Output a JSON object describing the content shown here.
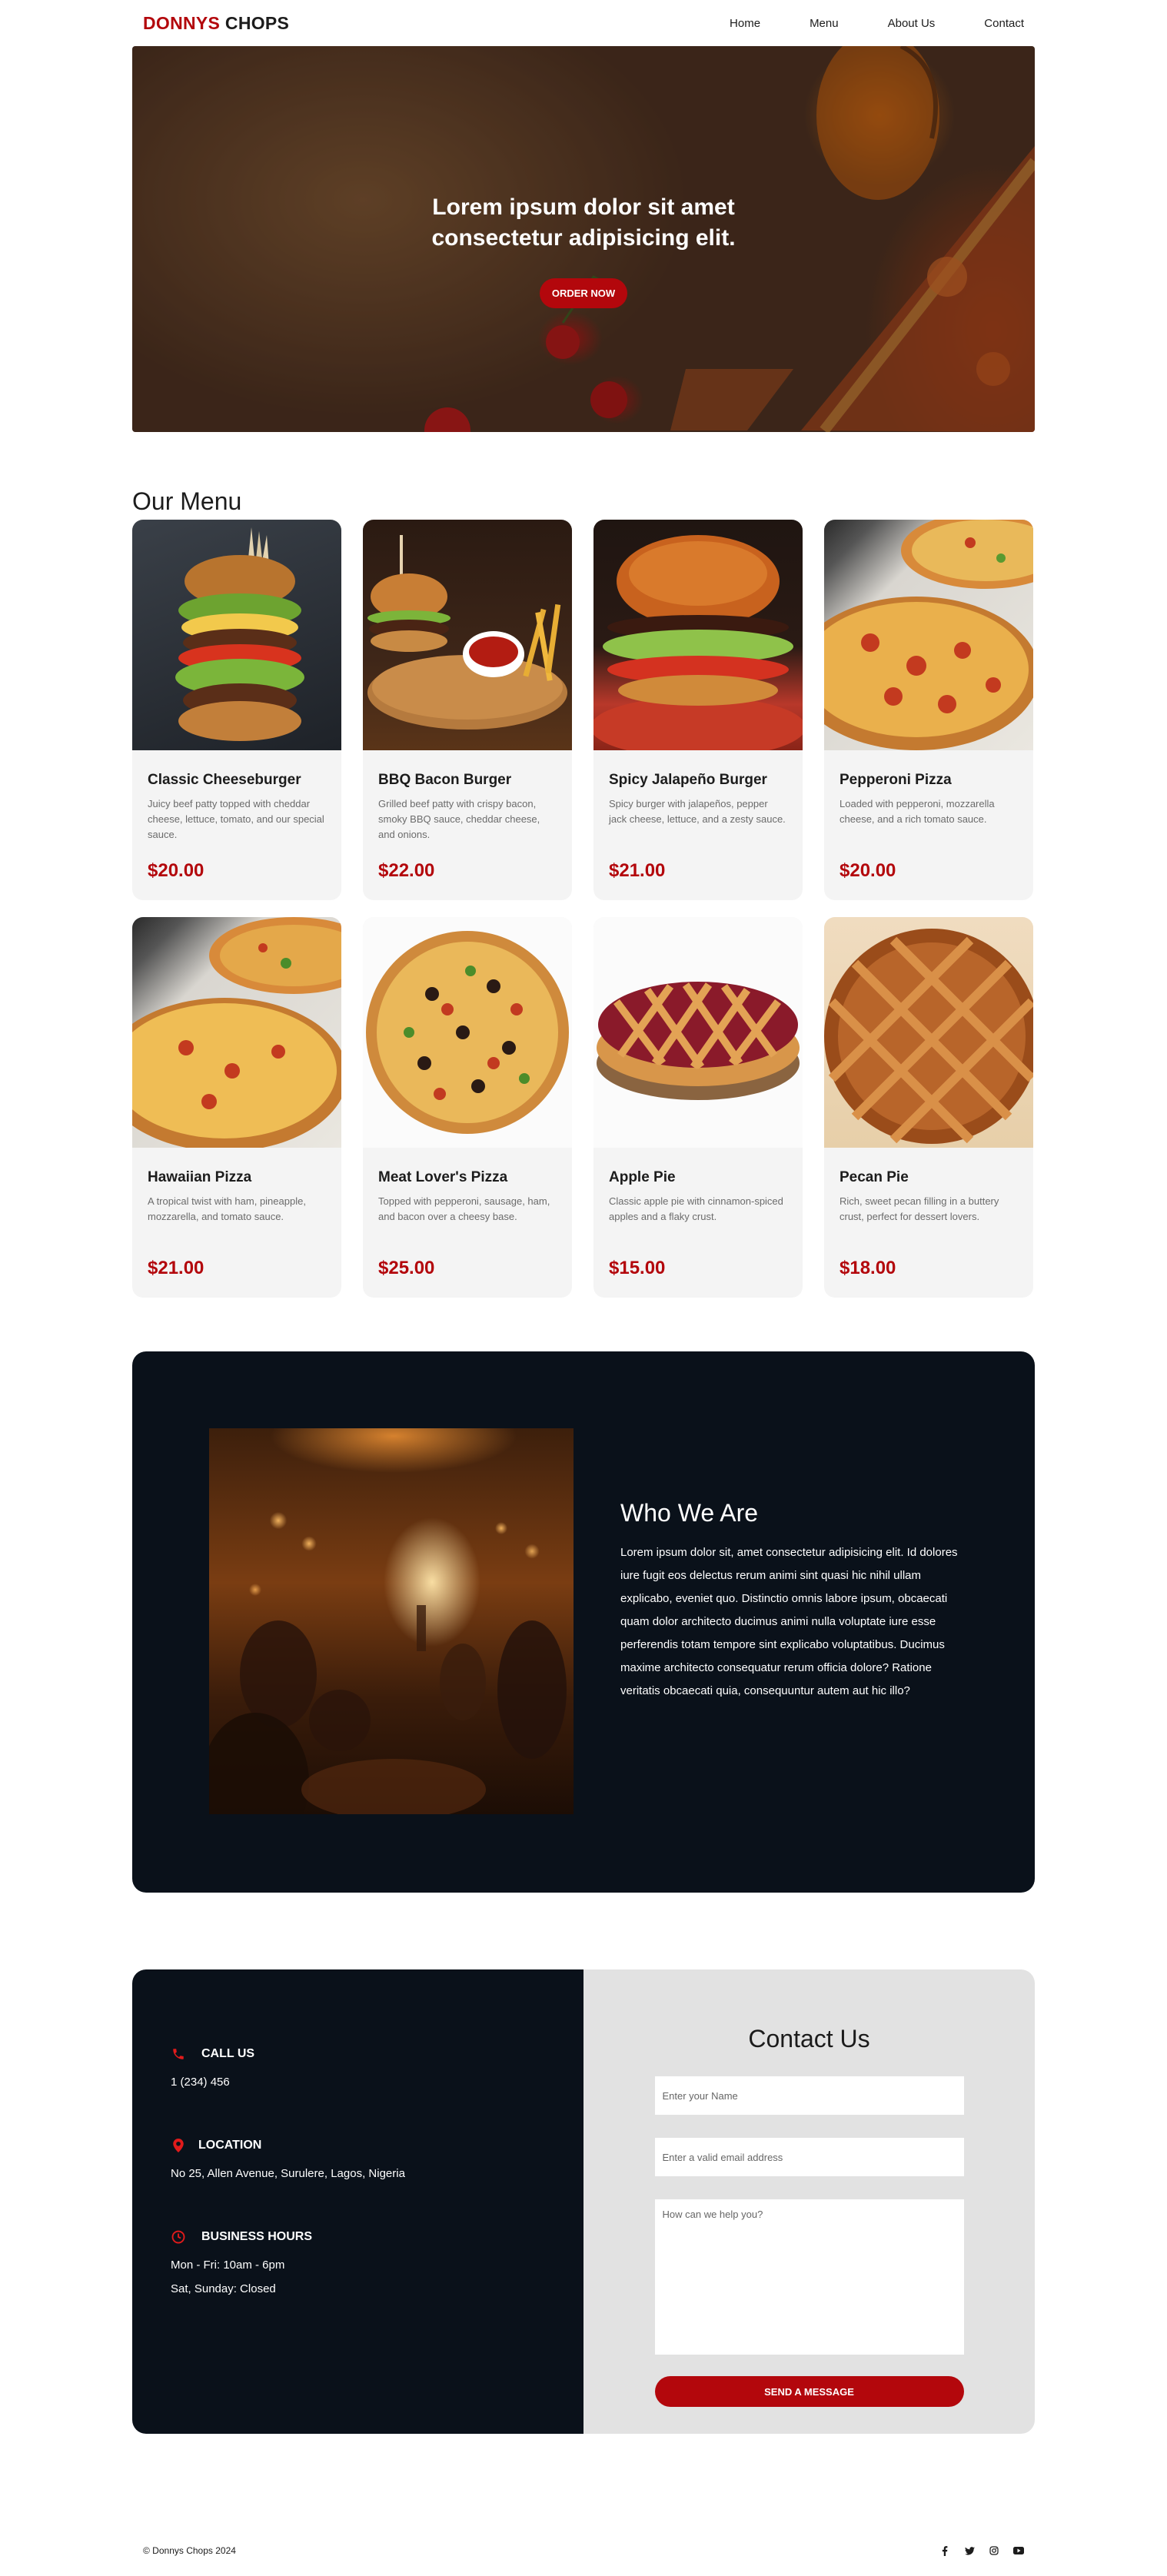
{
  "brand": {
    "part1": "DONNYS",
    "part2": "CHOPS"
  },
  "nav": [
    "Home",
    "Menu",
    "About Us",
    "Contact"
  ],
  "hero": {
    "title": "Lorem ipsum dolor sit amet consectetur adipisicing elit.",
    "button": "ORDER NOW"
  },
  "menu": {
    "title": "Our Menu",
    "items": [
      {
        "name": "Classic Cheeseburger",
        "desc": "Juicy beef patty topped with cheddar cheese, lettuce, tomato, and our special sauce.",
        "price": "$20.00",
        "icon": "burger-image"
      },
      {
        "name": "BBQ Bacon Burger",
        "desc": "Grilled beef patty with crispy bacon, smoky BBQ sauce, cheddar cheese, and onions.",
        "price": "$22.00",
        "icon": "burger-image"
      },
      {
        "name": "Spicy Jalapeño Burger",
        "desc": "Spicy burger with jalapeños, pepper jack cheese, lettuce, and a zesty sauce.",
        "price": "$21.00",
        "icon": "burger-image"
      },
      {
        "name": "Pepperoni Pizza",
        "desc": "Loaded with pepperoni, mozzarella cheese, and a rich tomato sauce.",
        "price": "$20.00",
        "icon": "pizza-image"
      },
      {
        "name": "Hawaiian Pizza",
        "desc": "A tropical twist with ham, pineapple, mozzarella, and tomato sauce.",
        "price": "$21.00",
        "icon": "pizza-image"
      },
      {
        "name": "Meat Lover's Pizza",
        "desc": "Topped with pepperoni, sausage, ham, and bacon over a cheesy base.",
        "price": "$25.00",
        "icon": "pizza-image"
      },
      {
        "name": "Apple Pie",
        "desc": "Classic apple pie with cinnamon-spiced apples and a flaky crust.",
        "price": "$15.00",
        "icon": "pie-image"
      },
      {
        "name": "Pecan Pie",
        "desc": "Rich, sweet pecan filling in a buttery crust, perfect for dessert lovers.",
        "price": "$18.00",
        "icon": "pie-image"
      }
    ]
  },
  "about": {
    "heading": "Who We Are",
    "body": "Lorem ipsum dolor sit, amet consectetur adipisicing elit. Id dolores iure fugit eos delectus rerum animi sint quasi hic nihil ullam explicabo, eveniet quo. Distinctio omnis labore ipsum, obcaecati quam dolor architecto ducimus animi nulla voluptate iure esse perferendis totam tempore sint explicabo voluptatibus. Ducimus maxime architecto consequatur rerum officia dolore? Ratione veritatis obcaecati quia, consequuntur autem aut hic illo?"
  },
  "contact_info": {
    "call": {
      "label": "CALL US",
      "value": "1 (234) 456"
    },
    "location": {
      "label": "LOCATION",
      "value": "No 25, Allen Avenue, Surulere, Lagos, Nigeria"
    },
    "hours": {
      "label": "BUSINESS HOURS",
      "line1": "Mon - Fri: 10am - 6pm",
      "line2": "Sat, Sunday: Closed"
    }
  },
  "contact_form": {
    "title": "Contact Us",
    "name_placeholder": "Enter your Name",
    "email_placeholder": "Enter a valid email address",
    "message_placeholder": "How can we help you?",
    "button": "SEND A MESSAGE"
  },
  "footer": {
    "copyright": "© Donnys Chops 2024",
    "social": [
      "facebook-icon",
      "twitter-icon",
      "instagram-icon",
      "youtube-icon"
    ]
  },
  "colors": {
    "accent": "#b3070c",
    "dark": "#0a111a",
    "card_bg": "#f4f4f4",
    "form_bg": "#e2e2e2"
  }
}
